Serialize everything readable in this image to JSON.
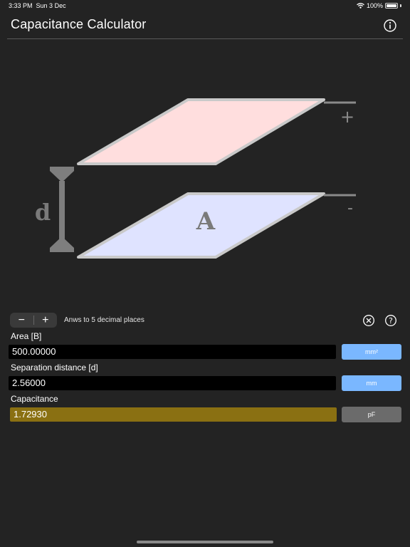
{
  "status": {
    "time": "3:33 PM",
    "date": "Sun 3 Dec",
    "battery": "100%",
    "battery_level": 1.0
  },
  "header": {
    "title": "Capacitance Calculator",
    "info_icon": "info-circle-icon"
  },
  "diagram": {
    "top_sign": "+",
    "bottom_sign": "-",
    "area_label": "A",
    "distance_label": "d"
  },
  "controls": {
    "decrement": "−",
    "increment": "+",
    "precision_text": "Anws to 5 decimal places",
    "clear_icon": "clear-circle-icon",
    "help_icon": "help-circle-icon"
  },
  "fields": {
    "area": {
      "label": "Area [B]",
      "value": "500.00000",
      "unit": "mm²"
    },
    "distance": {
      "label": "Separation distance [d]",
      "value": "2.56000",
      "unit": "mm"
    },
    "capacitance": {
      "label": "Capacitance",
      "value": "1.72930",
      "unit": "pF"
    }
  },
  "colors": {
    "background": "#232323",
    "unit_blue": "#7ab7ff",
    "result_gold": "#8a7012",
    "unit_gray": "#6b6b6b",
    "plate_top": "#ffdede",
    "plate_bottom": "#dfe3ff"
  }
}
